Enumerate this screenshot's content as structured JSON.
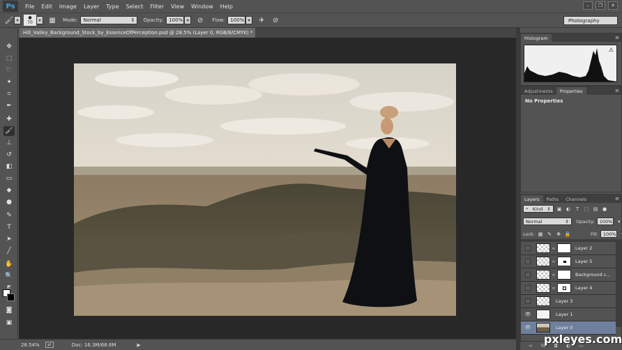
{
  "app": {
    "logo": "Ps"
  },
  "menu": [
    "File",
    "Edit",
    "Image",
    "Layer",
    "Type",
    "Select",
    "Filter",
    "View",
    "Window",
    "Help"
  ],
  "window_controls": {
    "minimize": "–",
    "restore": "❐",
    "close": "✕"
  },
  "options": {
    "brush_size": "70",
    "mode_label": "Mode:",
    "mode_value": "Normal",
    "opacity_label": "Opacity:",
    "opacity_value": "100%",
    "flow_label": "Flow:",
    "flow_value": "100%",
    "workspace": "Photography"
  },
  "document": {
    "tab_title": "Hill_Valley_Background_Stock_by_EssenceOfPerception.psd @ 28.5% (Layer 0, RGB/8/CMYK) *",
    "close": "×"
  },
  "status": {
    "zoom": "28.54%",
    "doc_info": "Doc: 16.3M/68.6M",
    "arrow": "▶"
  },
  "panels": {
    "histogram_tab": "Histogram",
    "adjustments_tab": "Adjustments",
    "properties_tab": "Properties",
    "no_properties": "No Properties",
    "layers_tab": "Layers",
    "paths_tab": "Paths",
    "channels_tab": "Channels"
  },
  "layers_panel": {
    "filter_kind": "Kind",
    "blend_mode": "Normal",
    "opacity_label": "Opacity:",
    "opacity_value": "100%",
    "lock_label": "Lock:",
    "fill_label": "Fill:",
    "fill_value": "100%"
  },
  "layers": [
    {
      "name": "Layer 2",
      "visible": false,
      "mask": "white",
      "selected": false
    },
    {
      "name": "Layer 5",
      "visible": false,
      "mask": "dot",
      "selected": false
    },
    {
      "name": "Background c...",
      "visible": false,
      "mask": "white",
      "selected": false
    },
    {
      "name": "Layer 4",
      "visible": false,
      "mask": "ring",
      "selected": false
    },
    {
      "name": "Layer 3",
      "visible": false,
      "mask": "none",
      "selected": false
    },
    {
      "name": "Layer 1",
      "visible": true,
      "mask": "none",
      "selected": false
    },
    {
      "name": "Layer 0",
      "visible": true,
      "mask": "none",
      "selected": true
    }
  ],
  "watermark": "pxleyes.com",
  "colors": {
    "accent": "#3ea6e0",
    "selected_layer": "#6f7f9e",
    "panel": "#535353",
    "canvas_bg": "#282828"
  }
}
